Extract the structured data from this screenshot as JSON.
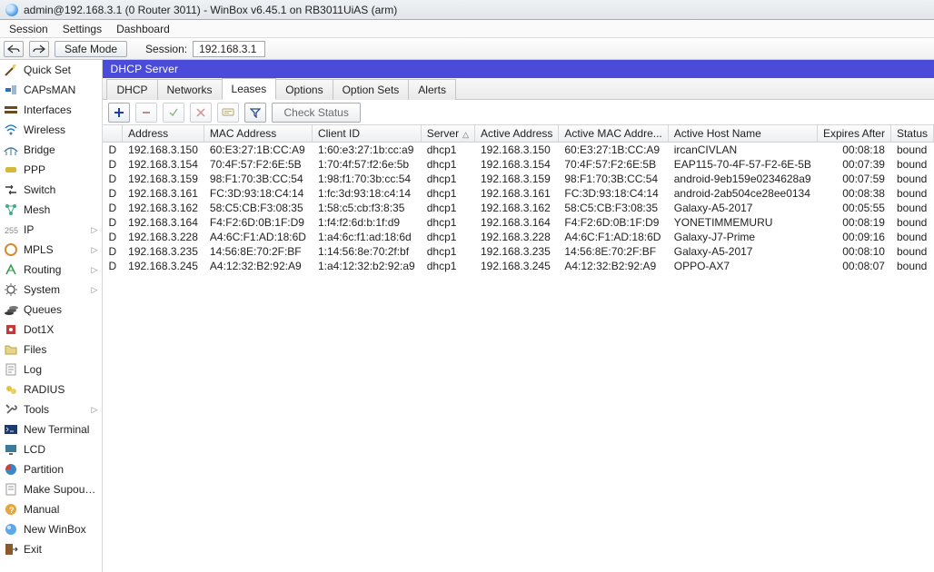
{
  "title": "admin@192.168.3.1 (0 Router 3011) - WinBox v6.45.1 on RB3011UiAS (arm)",
  "menu": {
    "session": "Session",
    "settings": "Settings",
    "dashboard": "Dashboard"
  },
  "toolbar": {
    "safe_mode": "Safe Mode",
    "session_label": "Session:",
    "session_value": "192.168.3.1"
  },
  "sidebar": {
    "items": [
      {
        "label": "Quick Set",
        "icon": "wand",
        "sub": false
      },
      {
        "label": "CAPsMAN",
        "icon": "caps",
        "sub": false
      },
      {
        "label": "Interfaces",
        "icon": "ifaces",
        "sub": false
      },
      {
        "label": "Wireless",
        "icon": "wifi",
        "sub": false
      },
      {
        "label": "Bridge",
        "icon": "bridge",
        "sub": false
      },
      {
        "label": "PPP",
        "icon": "ppp",
        "sub": false
      },
      {
        "label": "Switch",
        "icon": "switch",
        "sub": false
      },
      {
        "label": "Mesh",
        "icon": "mesh",
        "sub": false
      },
      {
        "label": "IP",
        "icon": "ip",
        "sub": true
      },
      {
        "label": "MPLS",
        "icon": "mpls",
        "sub": true
      },
      {
        "label": "Routing",
        "icon": "routing",
        "sub": true
      },
      {
        "label": "System",
        "icon": "system",
        "sub": true
      },
      {
        "label": "Queues",
        "icon": "queues",
        "sub": false
      },
      {
        "label": "Dot1X",
        "icon": "dot1x",
        "sub": false
      },
      {
        "label": "Files",
        "icon": "files",
        "sub": false
      },
      {
        "label": "Log",
        "icon": "log",
        "sub": false
      },
      {
        "label": "RADIUS",
        "icon": "radius",
        "sub": false
      },
      {
        "label": "Tools",
        "icon": "tools",
        "sub": true
      },
      {
        "label": "New Terminal",
        "icon": "terminal",
        "sub": false
      },
      {
        "label": "LCD",
        "icon": "lcd",
        "sub": false
      },
      {
        "label": "Partition",
        "icon": "partition",
        "sub": false
      },
      {
        "label": "Make Supout.rif",
        "icon": "supout",
        "sub": false
      },
      {
        "label": "Manual",
        "icon": "manual",
        "sub": false
      },
      {
        "label": "New WinBox",
        "icon": "winbox",
        "sub": false
      },
      {
        "label": "Exit",
        "icon": "exit",
        "sub": false
      }
    ]
  },
  "panel": {
    "title": "DHCP Server"
  },
  "tabs": {
    "items": [
      {
        "label": "DHCP"
      },
      {
        "label": "Networks"
      },
      {
        "label": "Leases"
      },
      {
        "label": "Options"
      },
      {
        "label": "Option Sets"
      },
      {
        "label": "Alerts"
      }
    ],
    "active_index": 2
  },
  "tool2": {
    "check_status": "Check Status"
  },
  "columns": {
    "flag": "",
    "address": "Address",
    "mac": "MAC Address",
    "cid": "Client ID",
    "server": "Server",
    "aaddr": "Active Address",
    "amac": "Active MAC Addre...",
    "host": "Active Host Name",
    "exp": "Expires After",
    "status": "Status"
  },
  "rows": [
    {
      "f": "D",
      "addr": "192.168.3.150",
      "mac": "60:E3:27:1B:CC:A9",
      "cid": "1:60:e3:27:1b:cc:a9",
      "srv": "dhcp1",
      "aaddr": "192.168.3.150",
      "amac": "60:E3:27:1B:CC:A9",
      "host": "ircanCIVLAN",
      "exp": "00:08:18",
      "stat": "bound"
    },
    {
      "f": "D",
      "addr": "192.168.3.154",
      "mac": "70:4F:57:F2:6E:5B",
      "cid": "1:70:4f:57:f2:6e:5b",
      "srv": "dhcp1",
      "aaddr": "192.168.3.154",
      "amac": "70:4F:57:F2:6E:5B",
      "host": "EAP115-70-4F-57-F2-6E-5B",
      "exp": "00:07:39",
      "stat": "bound"
    },
    {
      "f": "D",
      "addr": "192.168.3.159",
      "mac": "98:F1:70:3B:CC:54",
      "cid": "1:98:f1:70:3b:cc:54",
      "srv": "dhcp1",
      "aaddr": "192.168.3.159",
      "amac": "98:F1:70:3B:CC:54",
      "host": "android-9eb159e0234628a9",
      "exp": "00:07:59",
      "stat": "bound"
    },
    {
      "f": "D",
      "addr": "192.168.3.161",
      "mac": "FC:3D:93:18:C4:14",
      "cid": "1:fc:3d:93:18:c4:14",
      "srv": "dhcp1",
      "aaddr": "192.168.3.161",
      "amac": "FC:3D:93:18:C4:14",
      "host": "android-2ab504ce28ee0134",
      "exp": "00:08:38",
      "stat": "bound"
    },
    {
      "f": "D",
      "addr": "192.168.3.162",
      "mac": "58:C5:CB:F3:08:35",
      "cid": "1:58:c5:cb:f3:8:35",
      "srv": "dhcp1",
      "aaddr": "192.168.3.162",
      "amac": "58:C5:CB:F3:08:35",
      "host": "Galaxy-A5-2017",
      "exp": "00:05:55",
      "stat": "bound"
    },
    {
      "f": "D",
      "addr": "192.168.3.164",
      "mac": "F4:F2:6D:0B:1F:D9",
      "cid": "1:f4:f2:6d:b:1f:d9",
      "srv": "dhcp1",
      "aaddr": "192.168.3.164",
      "amac": "F4:F2:6D:0B:1F:D9",
      "host": "YONETIMMEMURU",
      "exp": "00:08:19",
      "stat": "bound"
    },
    {
      "f": "D",
      "addr": "192.168.3.228",
      "mac": "A4:6C:F1:AD:18:6D",
      "cid": "1:a4:6c:f1:ad:18:6d",
      "srv": "dhcp1",
      "aaddr": "192.168.3.228",
      "amac": "A4:6C:F1:AD:18:6D",
      "host": "Galaxy-J7-Prime",
      "exp": "00:09:16",
      "stat": "bound"
    },
    {
      "f": "D",
      "addr": "192.168.3.235",
      "mac": "14:56:8E:70:2F:BF",
      "cid": "1:14:56:8e:70:2f:bf",
      "srv": "dhcp1",
      "aaddr": "192.168.3.235",
      "amac": "14:56:8E:70:2F:BF",
      "host": "Galaxy-A5-2017",
      "exp": "00:08:10",
      "stat": "bound"
    },
    {
      "f": "D",
      "addr": "192.168.3.245",
      "mac": "A4:12:32:B2:92:A9",
      "cid": "1:a4:12:32:b2:92:a9",
      "srv": "dhcp1",
      "aaddr": "192.168.3.245",
      "amac": "A4:12:32:B2:92:A9",
      "host": "OPPO-AX7",
      "exp": "00:08:07",
      "stat": "bound"
    }
  ]
}
